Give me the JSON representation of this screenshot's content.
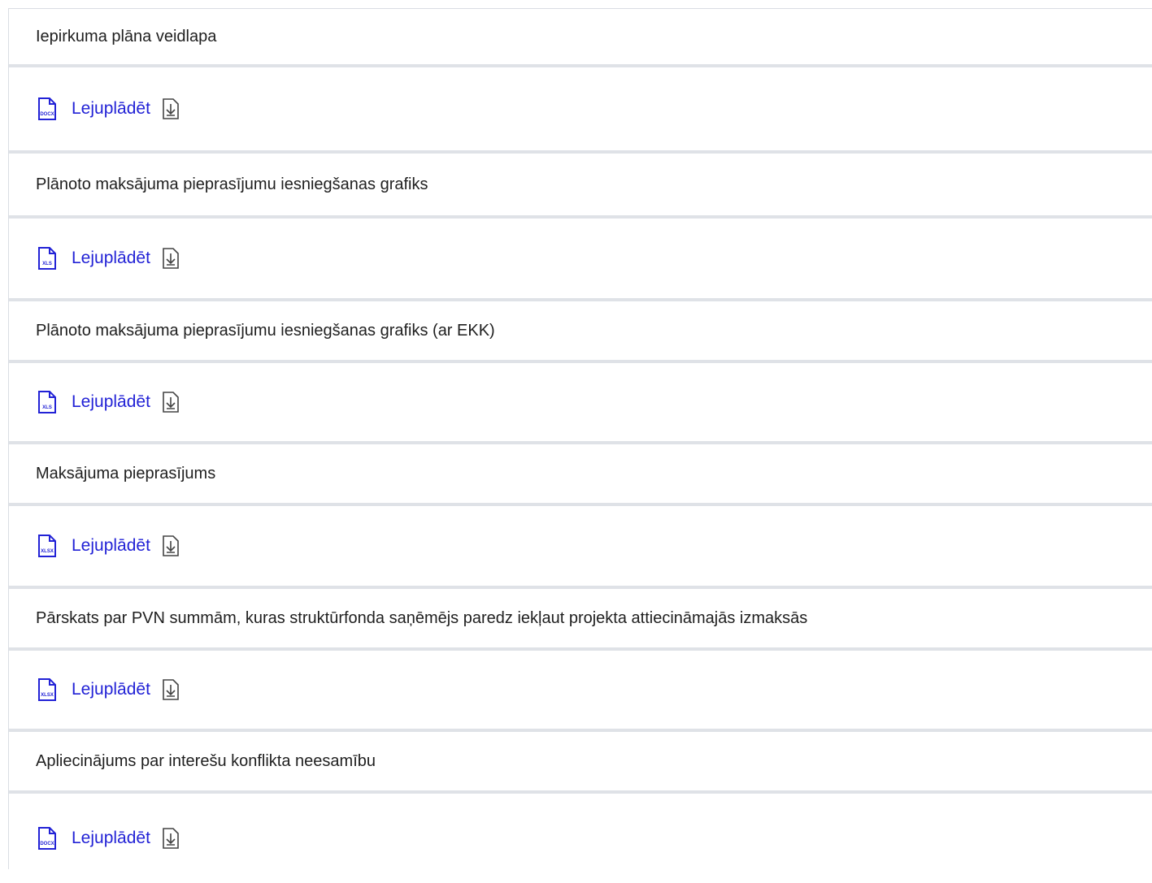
{
  "documents": [
    {
      "title": "Iepirkuma plāna veidlapa",
      "file_type": "DOCX",
      "download_label": "Lejuplādēt"
    },
    {
      "title": "Plānoto maksājuma pieprasījumu iesniegšanas grafiks",
      "file_type": "XLS",
      "download_label": "Lejuplādēt"
    },
    {
      "title": "Plānoto maksājuma pieprasījumu iesniegšanas grafiks (ar EKK)",
      "file_type": "XLS",
      "download_label": "Lejuplādēt"
    },
    {
      "title": "Maksājuma pieprasījums",
      "file_type": "XLSX",
      "download_label": "Lejuplādēt"
    },
    {
      "title": "Pārskats par PVN summām, kuras struktūrfonda saņēmējs paredz iekļaut projekta attiecināmajās izmaksās",
      "file_type": "XLSX",
      "download_label": "Lejuplādēt"
    },
    {
      "title": "Apliecinājums par interešu konflikta neesamību",
      "file_type": "DOCX",
      "download_label": "Lejuplādēt"
    }
  ],
  "icons": {
    "file": "file-icon",
    "download": "download-icon"
  },
  "colors": {
    "link": "#2222d6",
    "border": "#dfe2e7"
  }
}
